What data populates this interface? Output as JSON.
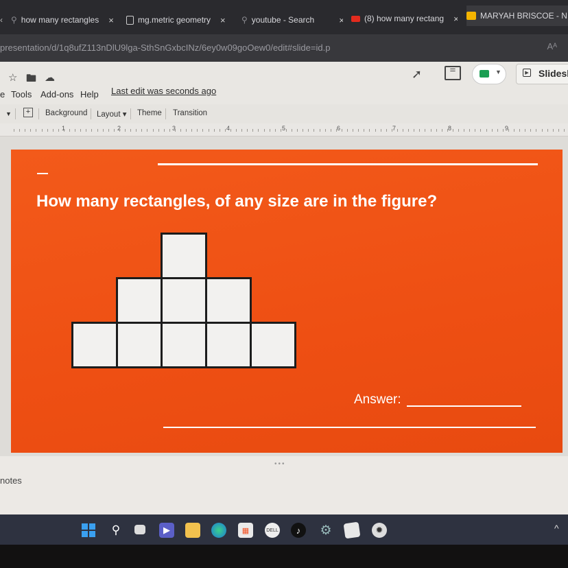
{
  "browser": {
    "tabs": [
      {
        "label": "how many rectangles",
        "icon": "search-icon",
        "close": "×"
      },
      {
        "label": "mg.metric geometry",
        "icon": "document-icon",
        "close": "×"
      },
      {
        "label": "youtube - Search",
        "icon": "search-icon",
        "close": "×"
      },
      {
        "label": "(8) how many rectang",
        "icon": "youtube-icon",
        "close": "×"
      },
      {
        "label": "MARYAH BRISCOE - N",
        "icon": "slides-icon",
        "close": "×"
      }
    ],
    "url": "presentation/d/1q8ufZ113nDlU9lga-SthSnGxbcINz/6ey0w09goOew0/edit#slide=id.p",
    "read_aloud": "Aᴬ"
  },
  "docs": {
    "menu": [
      "Tools",
      "Add-ons",
      "Help"
    ],
    "last_edit": "Last edit was seconds ago",
    "slideshow_label": "Slidesh",
    "toolbar": {
      "background_label": "Background",
      "layout_label": "Layout ▾",
      "theme_label": "Theme",
      "transition_label": "Transition"
    },
    "ruler_numbers": [
      "1",
      "2",
      "3",
      "4",
      "5",
      "6",
      "7",
      "8",
      "9"
    ]
  },
  "slide": {
    "title": "How many rectangles, of any size are in the figure?",
    "answer_label": "Answer:",
    "background_color": "#f0531a",
    "figure_rows": [
      1,
      3,
      5
    ]
  },
  "notes_label": "notes",
  "taskbar": {
    "icons": [
      "windows-start-icon",
      "search-icon",
      "task-view-icon",
      "teams-icon",
      "file-explorer-icon",
      "edge-icon",
      "store-icon",
      "dell-icon",
      "tiktok-icon",
      "settings-icon",
      "app-icon",
      "chatgpt-icon"
    ],
    "tray_chevron": "^"
  }
}
